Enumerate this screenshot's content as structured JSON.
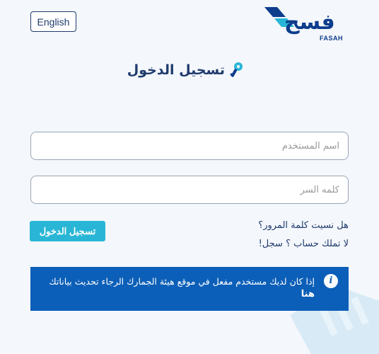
{
  "header": {
    "language_button": "English",
    "logo_text": "فسح",
    "logo_subtitle": "FASAH"
  },
  "login": {
    "title": "تسجيل الدخول",
    "username_placeholder": "اسم المستخدم",
    "password_placeholder": "كلمه السر",
    "submit_label": "تسجيل الدخول",
    "forgot_password": "هل نسيت كلمة المرور؟",
    "no_account_text": "لا تملك حساب ؟",
    "register_link": "سجل!"
  },
  "info": {
    "message": "إذا كان لديك مستخدم مفعل في موقع هيئة الجمارك الرجاء تحديث بياناتك",
    "link": "هنا"
  },
  "colors": {
    "primary": "#1f3b6e",
    "accent": "#29b6d6",
    "info_bg": "#0c5fb8",
    "background": "#f4f7fb"
  },
  "icons": {
    "title": "key-icon",
    "info": "info-icon"
  }
}
